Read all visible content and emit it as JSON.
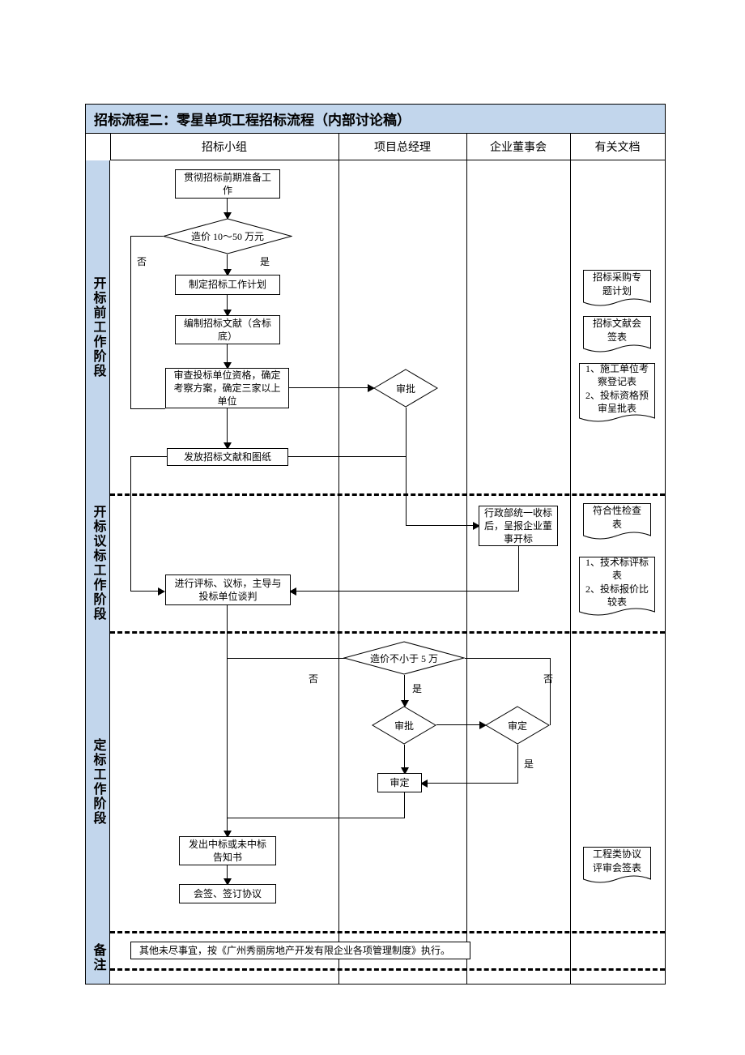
{
  "title": "招标流程二：零星单项工程招标流程（内部讨论稿）",
  "columns": {
    "c1": "招标小组",
    "c2": "项目总经理",
    "c3": "企业董事会",
    "c4": "有关文档"
  },
  "rows": {
    "r1": "开标前工作阶段",
    "r2": "开标议标工作阶段",
    "r3": "定标工作阶段",
    "r4": "备注"
  },
  "boxes": {
    "prep": "贯彻招标前期准备工作",
    "deci1": "造价 10～50 万元",
    "plan": "制定招标工作计划",
    "compile": "编制招标文献（含标底）",
    "review_units": "审查投标单位资格，确定考察方案，确定三家以上单位",
    "approve1": "审批",
    "issue_docs": "发放招标文献和图纸",
    "collect": "行政部统一收标后，呈报企业董事开标",
    "evaluate": "进行评标、议标，主导与投标单位谈判",
    "deci2": "造价不小于 5 万",
    "approve2": "审批",
    "approve3": "审定",
    "finalize": "审定",
    "notice": "发出中标或未中标告知书",
    "sign": "会签、签订协议",
    "remark": "其他未尽事宜，按《广州秀丽房地产开发有限企业各项管理制度》执行。"
  },
  "labels": {
    "yes": "是",
    "no": "否"
  },
  "docs": {
    "d1": "招标采购专题计划",
    "d2": "招标文献会签表",
    "d3": "1、施工单位考察登记表\n2、投标资格预审呈批表",
    "d4": "符合性检查表",
    "d5": "1、技术标评标表\n2、投标报价比较表",
    "d6": "工程类协议评审会签表"
  }
}
